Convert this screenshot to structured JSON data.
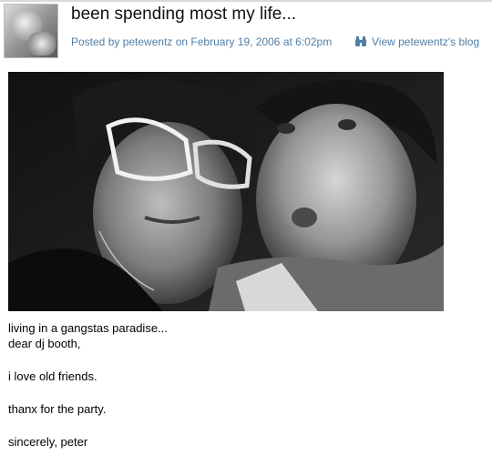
{
  "post": {
    "title": "been spending most my life...",
    "byline": "Posted by petewentz on February 19, 2006 at 6:02pm",
    "view_blog_label": "View petewentz's blog",
    "view_blog_icon": "binoculars-icon",
    "avatar_icon": "user-avatar"
  },
  "body": {
    "line1": "living in a gangstas paradise...",
    "line2": "dear dj booth,",
    "line3": "i love old friends.",
    "line4": "thanx for the party.",
    "line5": "sincerely, peter"
  },
  "colors": {
    "link": "#4f7fa8",
    "title": "#111111",
    "text": "#000000"
  }
}
